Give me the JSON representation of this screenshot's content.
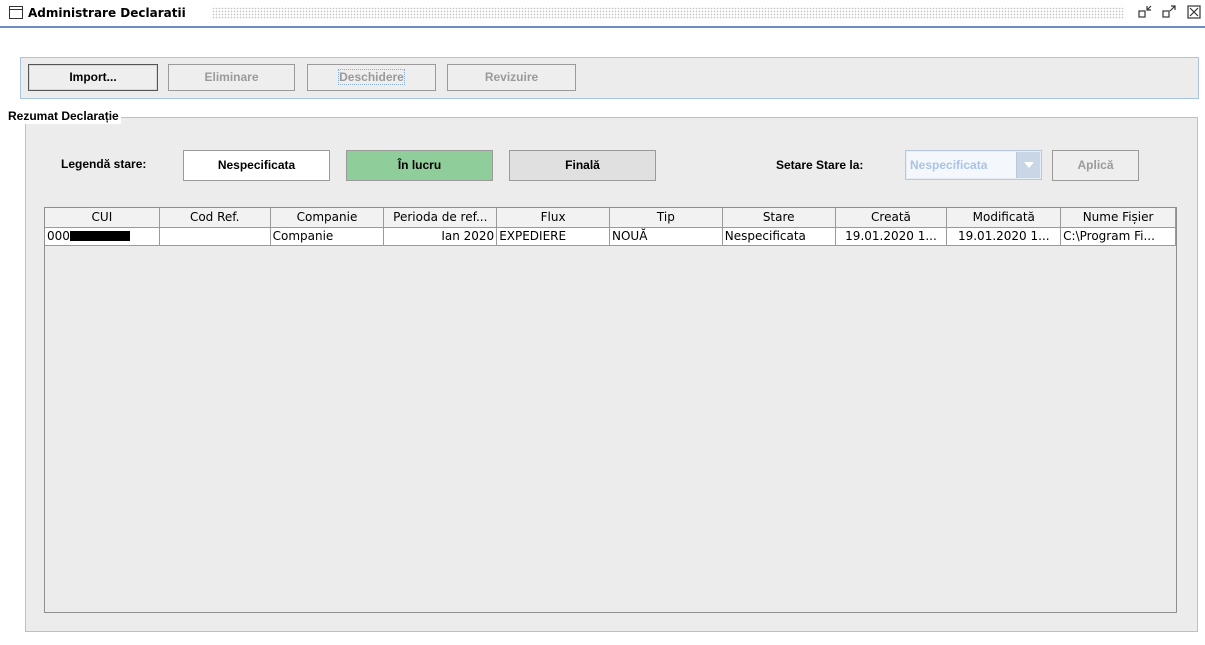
{
  "window": {
    "title": "Administrare Declaratii",
    "controls": [
      "restore-icon",
      "maximize-icon",
      "close-icon"
    ]
  },
  "toolbar": {
    "import_label": "Import...",
    "remove_label": "Eliminare",
    "open_label": "Deschidere",
    "review_label": "Revizuire"
  },
  "summary": {
    "group_title": "Rezumat Declarație",
    "legend_label": "Legendă stare:",
    "legend_unspecified": "Nespecificata",
    "legend_in_progress": "În lucru",
    "legend_final": "Finală",
    "set_status_label": "Setare Stare la:",
    "status_select_value": "Nespecificata",
    "apply_label": "Aplică"
  },
  "colors": {
    "in_progress": "#8fce9a",
    "final": "#e0e0e0",
    "unspecified": "#ffffff",
    "accent": "#6a8fbf"
  },
  "table": {
    "columns": [
      "CUI",
      "Cod Ref.",
      "Companie",
      "Perioda de ref...",
      "Flux",
      "Tip",
      "Stare",
      "Creată",
      "Modificată",
      "Nume Fișier"
    ],
    "rows": [
      {
        "cui_visible": "000",
        "cod_ref": "",
        "companie": "Companie",
        "perioada": "Ian 2020",
        "flux": "EXPEDIERE",
        "tip": "NOUĂ",
        "stare": "Nespecificata",
        "creata": "19.01.2020 1...",
        "modificata": "19.01.2020 1...",
        "nume_fisier": "C:\\Program Fi..."
      }
    ]
  }
}
